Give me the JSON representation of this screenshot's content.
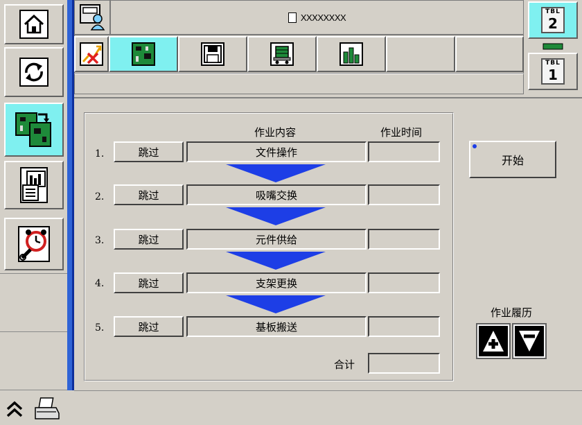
{
  "header": {
    "file_name": "XXXXXXXX"
  },
  "sidebar": {
    "items": [
      {
        "icon": "home-icon"
      },
      {
        "icon": "sync-icon"
      },
      {
        "icon": "pcb-transfer-icon",
        "active": true
      },
      {
        "icon": "report-chart-icon"
      },
      {
        "icon": "alarm-clock-wrench-icon"
      }
    ]
  },
  "toolbar": {
    "buttons": [
      {
        "icon": "disable-trend-icon"
      },
      {
        "icon": "pcb-icon",
        "active": true
      },
      {
        "icon": "floppy-disk-icon"
      },
      {
        "icon": "feeder-cart-icon"
      },
      {
        "icon": "bar-chart-icon"
      }
    ]
  },
  "tables": {
    "tbl_label": "TBL",
    "table_2": "2",
    "table_1": "1"
  },
  "steps": {
    "col_content": "作业内容",
    "col_time": "作业时间",
    "skip_label": "跳过",
    "items": [
      {
        "num": "1.",
        "content": "文件操作",
        "time": ""
      },
      {
        "num": "2.",
        "content": "吸嘴交换",
        "time": ""
      },
      {
        "num": "3.",
        "content": "元件供给",
        "time": ""
      },
      {
        "num": "4.",
        "content": "支架更换",
        "time": ""
      },
      {
        "num": "5.",
        "content": "基板搬送",
        "time": ""
      }
    ],
    "total_label": "合计",
    "total_value": ""
  },
  "actions": {
    "start_label": "开始",
    "history_label": "作业履历"
  },
  "colors": {
    "accent_active": "#7ff0f0",
    "sidebar_stripe": "#2f63d6",
    "arrow": "#1d3ee6"
  }
}
